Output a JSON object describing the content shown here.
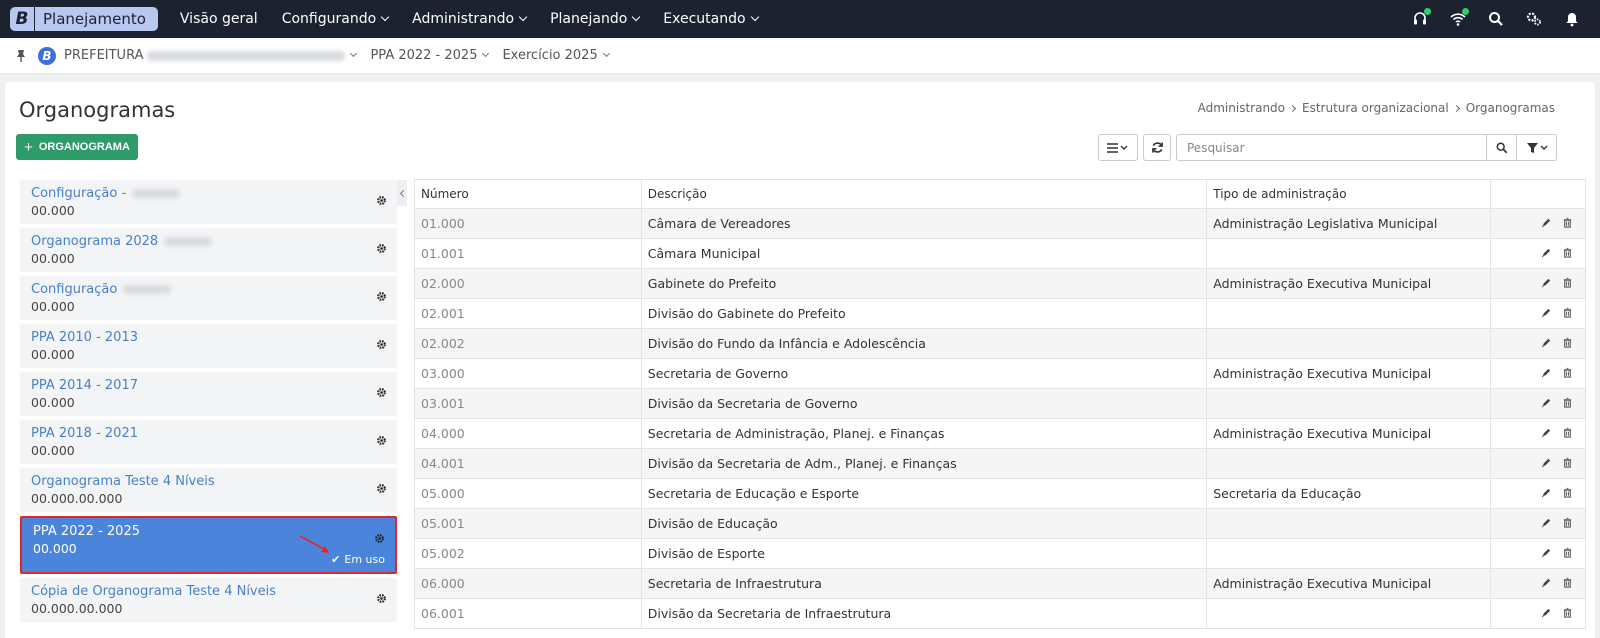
{
  "topbar": {
    "brand_letter": "B",
    "app_name": "Planejamento",
    "nav": [
      "Visão geral",
      "Configurando",
      "Administrando",
      "Planejando",
      "Executando"
    ],
    "nav_has_dropdown": [
      false,
      true,
      true,
      true,
      true
    ]
  },
  "context": {
    "entity": "PREFEITURA",
    "ppa": "PPA 2022 - 2025",
    "exercicio": "Exercício 2025"
  },
  "page": {
    "title": "Organogramas",
    "breadcrumb": [
      "Administrando",
      "Estrutura organizacional",
      "Organogramas"
    ],
    "add_button": "ORGANOGRAMA",
    "search_placeholder": "Pesquisar"
  },
  "organogramas": [
    {
      "name": "Configuração -",
      "code": "00.000",
      "blurred": true
    },
    {
      "name": "Organograma 2028",
      "code": "00.000",
      "blurred": true
    },
    {
      "name": "Configuração",
      "code": "00.000",
      "blurred": true
    },
    {
      "name": "PPA 2010 - 2013",
      "code": "00.000"
    },
    {
      "name": "PPA 2014 - 2017",
      "code": "00.000"
    },
    {
      "name": "PPA 2018 - 2021",
      "code": "00.000"
    },
    {
      "name": "Organograma Teste 4 Níveis",
      "code": "00.000.00.000"
    },
    {
      "name": "PPA 2022 - 2025",
      "code": "00.000",
      "active": true,
      "status": "Em uso"
    },
    {
      "name": "Cópia de Organograma Teste 4 Níveis",
      "code": "00.000.00.000"
    }
  ],
  "table": {
    "headers": [
      "Número",
      "Descrição",
      "Tipo de administração",
      ""
    ],
    "rows": [
      {
        "numero": "01.000",
        "descricao": "Câmara de Vereadores",
        "tipo": "Administração Legislativa Municipal"
      },
      {
        "numero": "01.001",
        "descricao": "Câmara Municipal",
        "tipo": ""
      },
      {
        "numero": "02.000",
        "descricao": "Gabinete do Prefeito",
        "tipo": "Administração Executiva Municipal"
      },
      {
        "numero": "02.001",
        "descricao": "Divisão do Gabinete do Prefeito",
        "tipo": ""
      },
      {
        "numero": "02.002",
        "descricao": "Divisão do Fundo da Infância e Adolescência",
        "tipo": ""
      },
      {
        "numero": "03.000",
        "descricao": "Secretaria de Governo",
        "tipo": "Administração Executiva Municipal"
      },
      {
        "numero": "03.001",
        "descricao": "Divisão da Secretaria de Governo",
        "tipo": ""
      },
      {
        "numero": "04.000",
        "descricao": "Secretaria de Administração, Planej. e Finanças",
        "tipo": "Administração Executiva Municipal"
      },
      {
        "numero": "04.001",
        "descricao": "Divisão da Secretaria de Adm., Planej. e Finanças",
        "tipo": ""
      },
      {
        "numero": "05.000",
        "descricao": "Secretaria de Educação e Esporte",
        "tipo": "Secretaria da Educação"
      },
      {
        "numero": "05.001",
        "descricao": "Divisão de Educação",
        "tipo": ""
      },
      {
        "numero": "05.002",
        "descricao": "Divisão de Esporte",
        "tipo": ""
      },
      {
        "numero": "06.000",
        "descricao": "Secretaria de Infraestrutura",
        "tipo": "Administração Executiva Municipal"
      },
      {
        "numero": "06.001",
        "descricao": "Divisão da Secretaria de Infraestrutura",
        "tipo": ""
      }
    ]
  },
  "colors": {
    "navbar": "#1d2230",
    "accent": "#4a84db",
    "add_button": "#2e9b6a",
    "highlight": "#e0252d",
    "link": "#4a7fc8"
  },
  "icons": [
    "headset-icon",
    "wifi-icon",
    "search-icon",
    "settings-icon",
    "bell-icon",
    "pin-icon",
    "gear-icon",
    "pencil-icon",
    "trash-icon",
    "filter-icon",
    "list-icon",
    "refresh-icon",
    "check-icon"
  ]
}
